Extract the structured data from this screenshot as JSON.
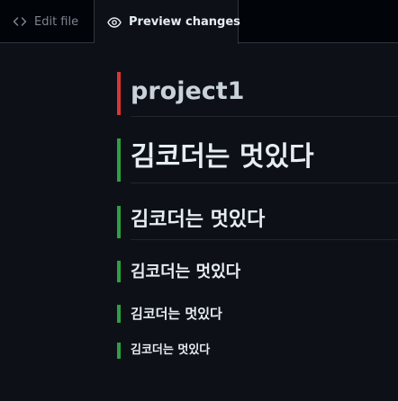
{
  "tabs": {
    "edit_label": "Edit file",
    "preview_label": "Preview changes"
  },
  "preview": {
    "headings": [
      {
        "level": "h1",
        "text": "project1",
        "marker": "removed"
      },
      {
        "level": "h1",
        "text": "김코더는 멋있다",
        "marker": "added"
      },
      {
        "level": "h2",
        "text": "김코더는 멋있다",
        "marker": "added"
      },
      {
        "level": "h3",
        "text": "김코더는 멋있다",
        "marker": "added"
      },
      {
        "level": "h4",
        "text": "김코더는 멋있다",
        "marker": "added"
      },
      {
        "level": "h5",
        "text": "김코더는 멋있다",
        "marker": "added"
      }
    ]
  },
  "colors": {
    "removed_marker": "#da3633",
    "added_marker": "#2ea043",
    "background": "#0d1117",
    "text": "#e6edf3",
    "muted_text": "#7d8590"
  }
}
